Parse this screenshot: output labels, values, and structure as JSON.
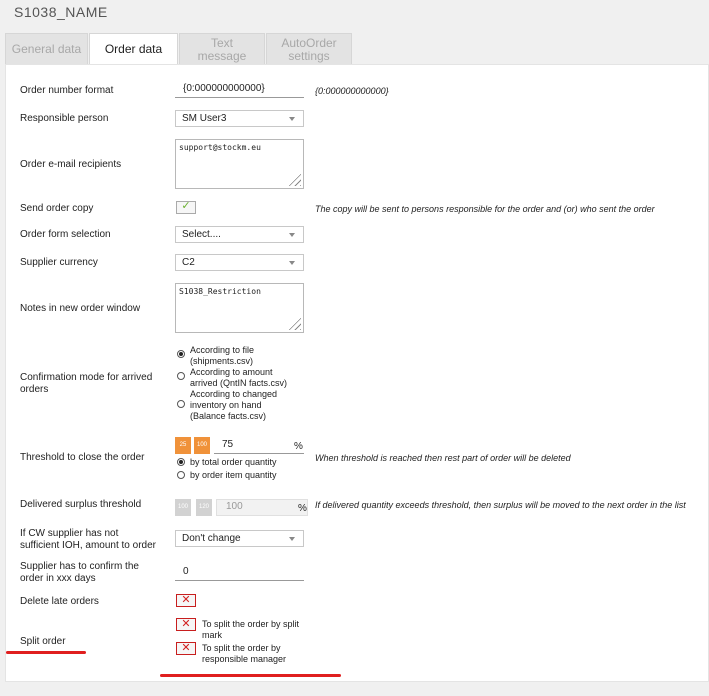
{
  "page_title": "S1038_NAME",
  "tabs": [
    "General data",
    "Order data",
    "Text message",
    "AutoOrder settings"
  ],
  "tabs_lines": [
    [
      "General data"
    ],
    [
      "Order data"
    ],
    [
      "Text",
      "message"
    ],
    [
      "AutoOrder",
      "settings"
    ]
  ],
  "fields": {
    "order_number_format": {
      "label": "Order number format",
      "value": "{0:000000000000}",
      "hint": "{0:000000000000}"
    },
    "responsible_person": {
      "label": "Responsible person",
      "value": "SM User3"
    },
    "order_email": {
      "label": "Order e-mail recipients",
      "value": "support@stockm.eu"
    },
    "send_order_copy": {
      "label": "Send order copy",
      "checked": true,
      "note": "The copy will be sent to persons responsible for the order and (or) who sent the order"
    },
    "order_form_selection": {
      "label": "Order form selection",
      "value": "Select...."
    },
    "supplier_currency": {
      "label": "Supplier currency",
      "value": "C2"
    },
    "notes_new_order": {
      "label": "Notes in new order window",
      "value": "S1038_Restriction"
    },
    "confirmation_mode": {
      "label_lines": [
        "Confirmation mode for arrived",
        "orders"
      ],
      "options": [
        {
          "lines": [
            "According to file",
            "(shipments.csv)"
          ],
          "selected": true
        },
        {
          "lines": [
            "According to amount",
            "arrived (QntIN facts.csv)"
          ],
          "selected": false
        },
        {
          "lines": [
            "According to changed",
            "inventory on hand",
            "(Balance facts.csv)"
          ],
          "selected": false
        }
      ]
    },
    "threshold_close": {
      "label": "Threshold to close the order",
      "btn1": "25",
      "btn2": "100",
      "value": "75",
      "unit": "%",
      "note": "When threshold is reached then rest part of order will be deleted",
      "options": [
        {
          "label": "by total order quantity",
          "selected": true
        },
        {
          "label": "by order item quantity",
          "selected": false
        }
      ]
    },
    "delivered_surplus": {
      "label": "Delivered surplus threshold",
      "btn1": "100",
      "btn2": "120",
      "value": "100",
      "unit": "%",
      "note": "If delivered quantity exceeds threshold, then surplus will be moved to the next order in the list"
    },
    "cw_supplier": {
      "label_lines": [
        "If CW supplier has not",
        "sufficient IOH, amount to order"
      ],
      "value": "Don't change"
    },
    "confirm_days": {
      "label_lines": [
        "Supplier has to confirm the",
        "order in xxx days"
      ],
      "value": "0"
    },
    "delete_late": {
      "label": "Delete late orders",
      "checked": false
    },
    "split_order": {
      "label": "Split order",
      "options": [
        {
          "lines": [
            "To split the order by split",
            "mark"
          ],
          "checked": false
        },
        {
          "lines": [
            "To split the order by",
            "responsible manager"
          ],
          "checked": false
        }
      ]
    }
  },
  "colors": {
    "accent": "#f0923a",
    "annotation": "#e01f1f",
    "check_green": "#6bb030",
    "x_red": "#d11f1f"
  }
}
